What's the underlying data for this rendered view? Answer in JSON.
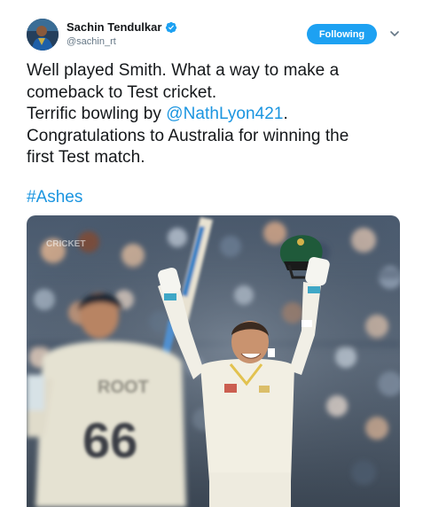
{
  "author": {
    "display_name": "Sachin Tendulkar",
    "handle": "@sachin_rt",
    "verified_icon": "verified-badge-icon"
  },
  "follow_button": {
    "label": "Following",
    "color": "#1da1f2"
  },
  "menu": {
    "icon": "chevron-down-icon"
  },
  "tweet": {
    "lines": [
      "Well played Smith. What a way to make a",
      "comeback to Test cricket.",
      "Terrific bowling by ",
      "Congratulations to Australia for winning the",
      "first Test match."
    ],
    "mention": "@NathLyon421",
    "line3_suffix": ".",
    "hashtag": "#Ashes",
    "link_color": "#1b95e0"
  },
  "media": {
    "watermark": "CRICKET",
    "player_back_name": "ROOT",
    "player_back_number": "66"
  }
}
